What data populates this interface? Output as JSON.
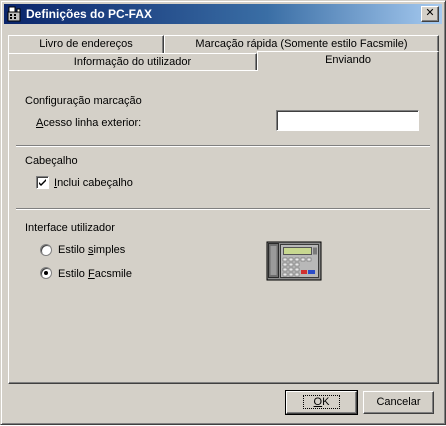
{
  "window": {
    "title": "Definições do PC-FAX",
    "close_symbol": "✕",
    "title_icon": "fax-app-icon"
  },
  "tabs": {
    "row_back": [
      {
        "label": "Livro de endereços"
      },
      {
        "label": "Marcação rápida (Somente estilo Facsmile)"
      }
    ],
    "row_front": [
      {
        "label": "Informação do utilizador"
      },
      {
        "label": "Enviando",
        "active": true
      }
    ]
  },
  "dialing": {
    "group_label": "Configuração marcação",
    "outside_line_label_pre": "",
    "outside_line_label_mnemonic": "A",
    "outside_line_label_post": "cesso linha exterior:",
    "outside_line_value": ""
  },
  "header": {
    "group_label": "Cabeçalho",
    "checkbox_mnemonic": "I",
    "checkbox_label_post": "nclui cabeçalho",
    "checked": true
  },
  "ui": {
    "group_label": "Interface utilizador",
    "options": [
      {
        "pre": "Estilo ",
        "mnemonic": "s",
        "post": "imples",
        "selected": false
      },
      {
        "pre": "Estilo ",
        "mnemonic": "F",
        "post": "acsmile",
        "selected": true
      }
    ],
    "image_icon": "fax-machine-icon"
  },
  "buttons": {
    "ok_mnemonic": "O",
    "ok_post": "K",
    "cancel_label": "Cancelar"
  },
  "colors": {
    "title_gradient_start": "#0a246a",
    "title_gradient_end": "#a6caf0",
    "face": "#d4d0c8"
  }
}
